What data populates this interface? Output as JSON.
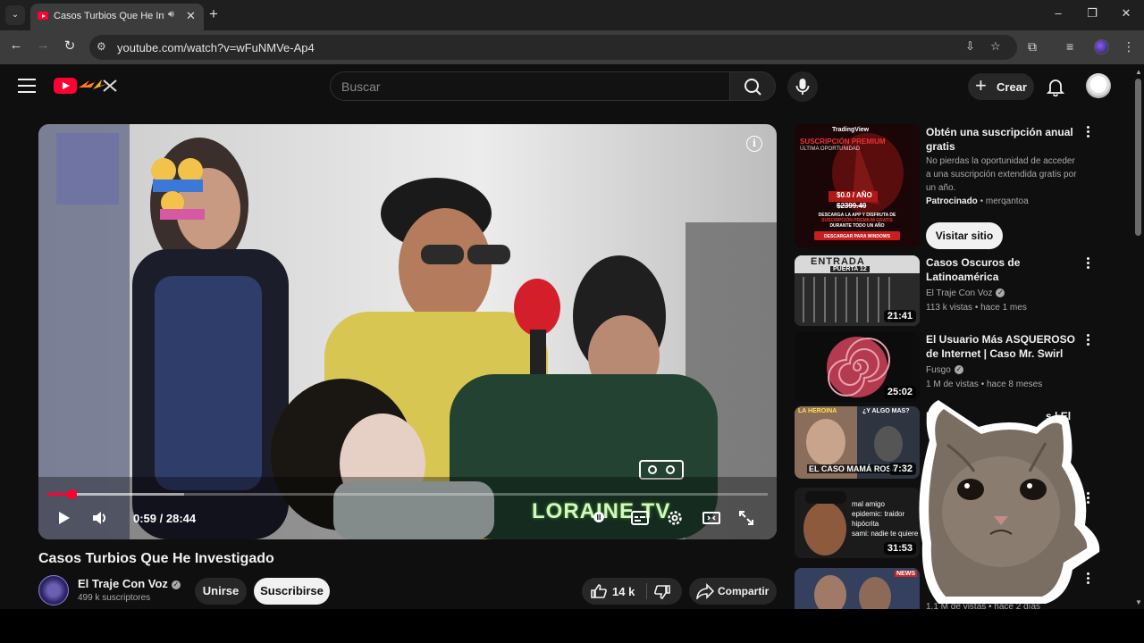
{
  "browser": {
    "tab_title": "Casos Turbios Que He Investigado - YouTube",
    "url": "youtube.com/watch?v=wFuNMVe-Ap4"
  },
  "header": {
    "search_placeholder": "Buscar",
    "create_label": "Crear"
  },
  "player": {
    "time": "0:59 / 28:44",
    "progress_fraction": 0.034,
    "buffered_fraction": 0.19,
    "watermark": "LORAINE TV"
  },
  "video": {
    "title": "Casos Turbios Que He Investigado",
    "channel": "El Traje Con Voz",
    "subscribers": "499 k suscriptores",
    "join_label": "Unirse",
    "subscribe_label": "Suscribirse",
    "likes": "14 k",
    "share_label": "Compartir"
  },
  "sidebar": {
    "ad": {
      "title": "Obtén una suscripción anual gratis",
      "description": "No pierdas la oportunidad de acceder a una suscripción extendida gratis por un año.",
      "sponsored": "Patrocinado",
      "advertiser": "merqantoa",
      "cta": "Visitar sitio",
      "thumb_text": {
        "brand": "TradingView",
        "headline": "SUSCRIPCIÓN PREMIUM",
        "sub": "ÚLTIMA OPORTUNIDAD",
        "price": "$0.0 / AÑO",
        "old_price": "$2399.40",
        "line1": "DESCARGA LA APP Y DISFRUTA DE",
        "line2": "SUSCRIPCIÓN PREMIUM GRATIS",
        "line3": "DURANTE TODO UN AÑO",
        "button": "DESCARGAR PARA WINDOWS"
      }
    },
    "videos": [
      {
        "title": "Casos Oscuros de Latinoamérica",
        "channel": "El Traje Con Voz",
        "meta": "113 k vistas • hace 1 mes",
        "duration": "21:41",
        "thumb_text": "ENTRADA",
        "thumb_sign": "PUERTA 12"
      },
      {
        "title": "El Usuario Más ASQUEROSO de Internet | Caso Mr. Swirl",
        "channel": "Fusgo",
        "meta": "1 M de vistas • hace 8 meses",
        "duration": "25:02"
      },
      {
        "title": "El",
        "title_right": "s | El",
        "duration": "7:32",
        "thumb_top_left": "LA HEROINA",
        "thumb_top_right": "¿Y ALGO MAS?",
        "thumb_bottom": "EL CASO MAMÁ ROSA"
      },
      {
        "duration": "31:53",
        "thumb_lines": [
          "mal amigo",
          "epidemic: traidor",
          "hipócrita",
          "sami: nadie te quiere"
        ]
      },
      {
        "meta": "1,1 M de vistas • hace 2 días",
        "thumb_badge": "NEWS"
      }
    ]
  },
  "colors": {
    "background": "#0f0f0f",
    "accent": "#ff0033",
    "chrome": "#3c3c3c"
  }
}
